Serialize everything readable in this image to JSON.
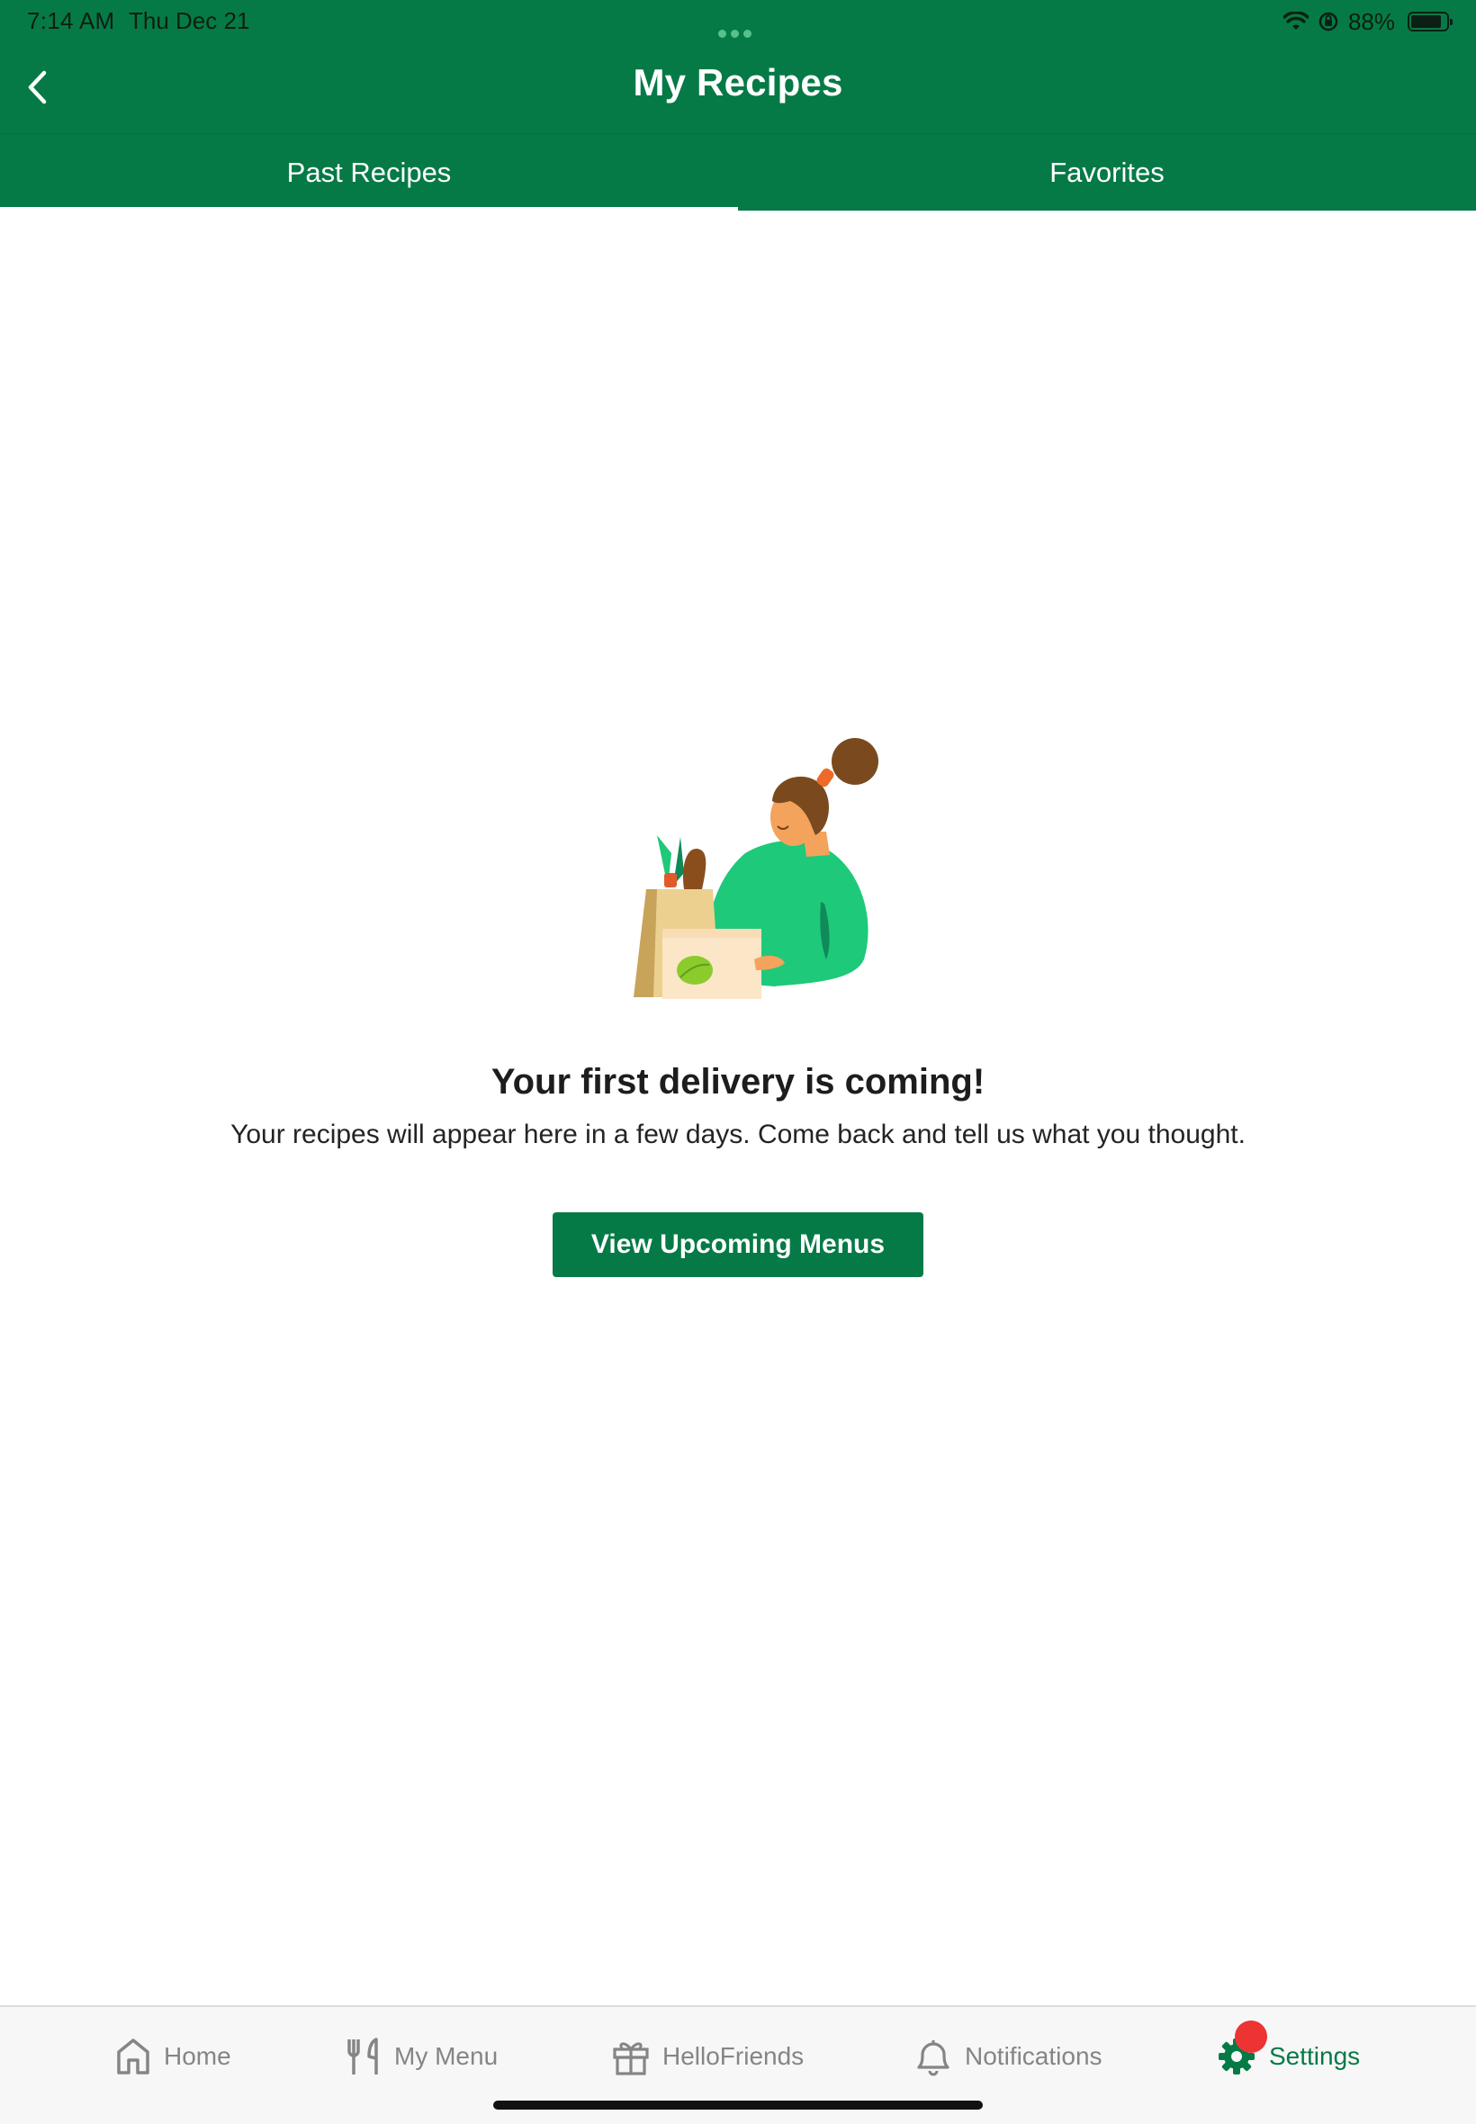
{
  "status_bar": {
    "time": "7:14 AM",
    "date": "Thu Dec 21",
    "battery_percent": "88%",
    "battery_level": 0.88
  },
  "header": {
    "title": "My Recipes",
    "back_icon": "chevron-left-icon"
  },
  "tabs": [
    {
      "label": "Past Recipes",
      "selected": true
    },
    {
      "label": "Favorites",
      "selected": false
    }
  ],
  "empty_state": {
    "illustration": "person-with-grocery-bag",
    "title": "Your first delivery is coming!",
    "subtitle": "Your recipes will appear here in a few days. Come back and tell us what you thought.",
    "button_label": "View Upcoming Menus"
  },
  "bottom_nav": [
    {
      "label": "Home",
      "icon": "home-icon",
      "active": false
    },
    {
      "label": "My Menu",
      "icon": "fork-knife-icon",
      "active": false
    },
    {
      "label": "HelloFriends",
      "icon": "gift-icon",
      "active": false
    },
    {
      "label": "Notifications",
      "icon": "bell-icon",
      "active": false
    },
    {
      "label": "Settings",
      "icon": "gear-icon",
      "active": true,
      "badge": true
    }
  ],
  "colors": {
    "brand_green": "#067a46",
    "tab_bar_bg": "#f7f7f7",
    "inactive_nav": "#858585",
    "badge_red": "#ee3333"
  }
}
